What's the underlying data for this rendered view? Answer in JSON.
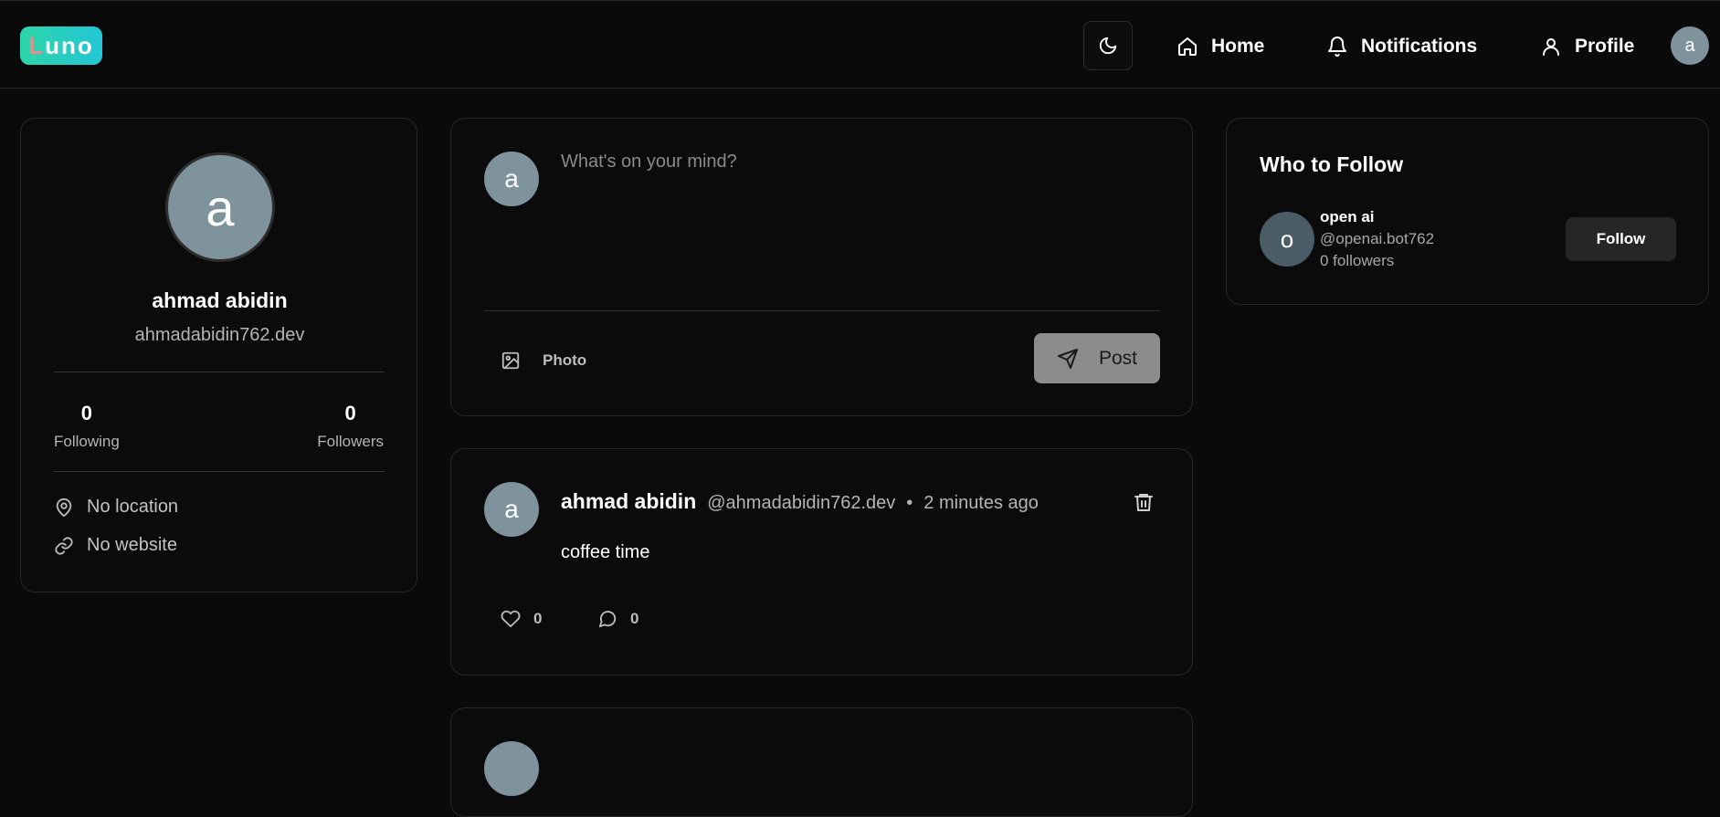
{
  "header": {
    "logo": {
      "first_letter": "L",
      "rest": "uno"
    },
    "nav": [
      {
        "label": "Home",
        "icon": "home-icon"
      },
      {
        "label": "Notifications",
        "icon": "bell-icon"
      },
      {
        "label": "Profile",
        "icon": "user-icon"
      }
    ],
    "theme_icon": "moon-icon",
    "avatar_initial": "a"
  },
  "profile": {
    "avatar_initial": "a",
    "name": "ahmad abidin",
    "handle": "ahmadabidin762.dev",
    "following_count": "0",
    "following_label": "Following",
    "followers_count": "0",
    "followers_label": "Followers",
    "location": "No location",
    "website": "No website"
  },
  "composer": {
    "avatar_initial": "a",
    "placeholder": "What's on your mind?",
    "photo_label": "Photo",
    "post_label": "Post"
  },
  "posts": [
    {
      "avatar_initial": "a",
      "author": "ahmad abidin",
      "handle": "@ahmadabidin762.dev",
      "separator": "•",
      "time": "2 minutes ago",
      "content": "coffee time",
      "likes": "0",
      "comments": "0"
    }
  ],
  "who_to_follow": {
    "title": "Who to Follow",
    "users": [
      {
        "avatar_initial": "o",
        "name": "open ai",
        "handle": "@openai.bot762",
        "followers": "0 followers",
        "button": "Follow"
      }
    ]
  },
  "colors": {
    "background": "#0a0a0a",
    "logo_gradient_start": "#2dd4a8",
    "logo_gradient_end": "#22c7d6",
    "avatar": "#7f939c",
    "post_button": "#8c8c8c"
  }
}
